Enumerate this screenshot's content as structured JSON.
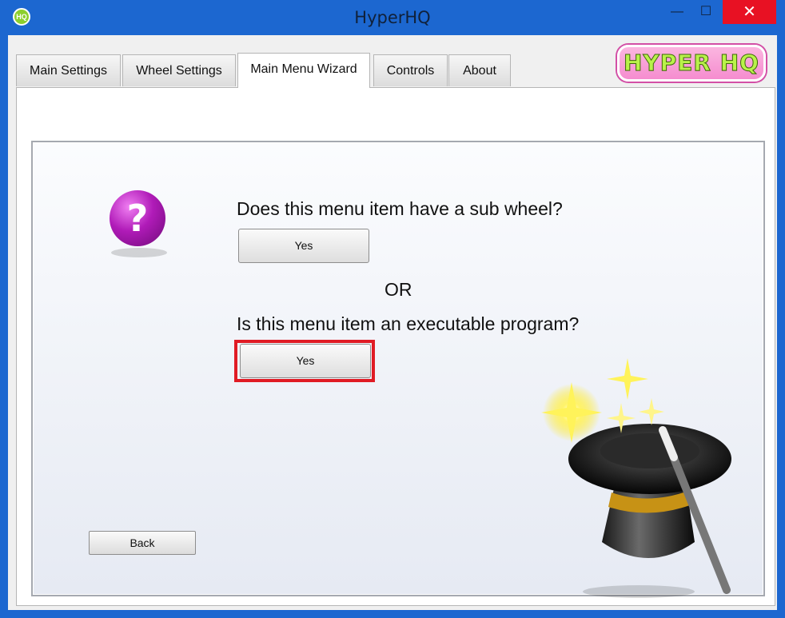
{
  "window": {
    "title": "HyperHQ",
    "icon_label": "HQ",
    "controls": {
      "minimize": "—",
      "maximize": "☐",
      "close": "✕"
    }
  },
  "tabs": [
    {
      "label": "Main Settings",
      "active": false
    },
    {
      "label": "Wheel Settings",
      "active": false
    },
    {
      "label": "Main Menu Wizard",
      "active": true
    },
    {
      "label": "Controls",
      "active": false
    },
    {
      "label": "About",
      "active": false
    }
  ],
  "logo": {
    "text": "HYPER HQ"
  },
  "wizard": {
    "question_sub_wheel": "Does this menu item have a sub wheel?",
    "yes_sub_wheel": "Yes",
    "or_label": "OR",
    "question_executable": "Is this menu item an executable program?",
    "yes_executable": "Yes",
    "back": "Back"
  },
  "icons": {
    "help": "question-mark-icon",
    "art": "magic-hat-wand-icon"
  },
  "colors": {
    "titlebar": "#1c67d0",
    "close": "#e81123",
    "highlight": "#e01b24",
    "question_icon": "#b01bb8"
  }
}
